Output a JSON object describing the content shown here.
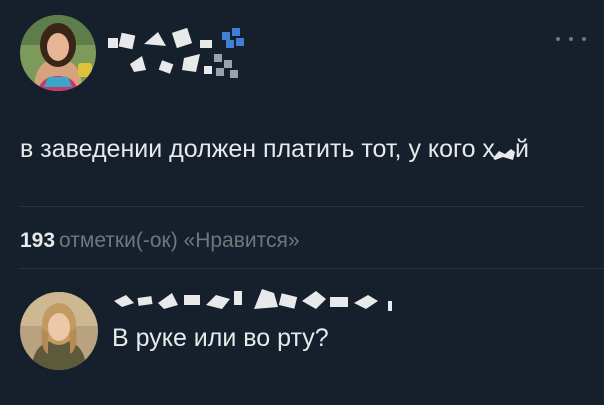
{
  "tweet": {
    "text_main": "в заведении должен платить тот, у кого х",
    "text_tail": "й",
    "more_icon": "more-horizontal-icon"
  },
  "engagement": {
    "likes_count": "193",
    "likes_label": "отметки(-ок) «Нравится»"
  },
  "reply": {
    "text": "В руке или во рту?"
  },
  "colors": {
    "background": "#16202c",
    "text_primary": "#e7e9ea",
    "text_secondary": "#71767b",
    "divider": "#2f3336"
  }
}
